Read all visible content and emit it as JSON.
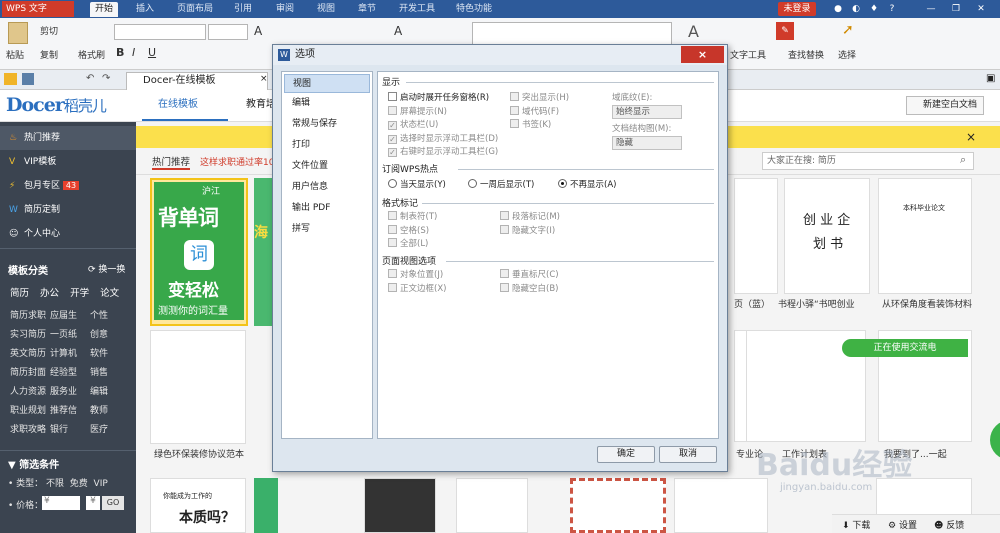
{
  "app": {
    "name": "WPS 文字",
    "login": "未登录"
  },
  "menu": [
    "开始",
    "插入",
    "页面布局",
    "引用",
    "审阅",
    "视图",
    "章节",
    "开发工具",
    "特色功能"
  ],
  "ribbon": {
    "paste": "粘贴",
    "cut": "剪切",
    "copy": "复制",
    "format_painter": "格式刷",
    "text_tools": "文字工具",
    "find_replace": "查找替换",
    "select": "选择"
  },
  "tab": {
    "name": "Docer-在线模板"
  },
  "docer": {
    "logo": "Docer",
    "logo_cn": "稻壳儿",
    "tab_online": "在线模板",
    "tab_edu": "教育培训",
    "new_blank": "新建空白文档"
  },
  "sidebar": {
    "items": [
      "热门推荐",
      "VIP模板",
      "包月专区",
      "简历定制",
      "个人中心"
    ],
    "month_badge": "43",
    "category_title": "模板分类",
    "switch": "换一换",
    "tags_row": [
      "简历",
      "办公",
      "开学",
      "论文"
    ],
    "cats": [
      [
        "简历求职",
        "应届生",
        "个性"
      ],
      [
        "实习简历",
        "一页纸",
        "创意"
      ],
      [
        "英文简历",
        "计算机",
        "软件"
      ],
      [
        "简历封面",
        "经验型",
        "销售"
      ],
      [
        "人力资源",
        "服务业",
        "编辑"
      ],
      [
        "职业规划",
        "推荐信",
        "教师"
      ],
      [
        "求职攻略",
        "银行",
        "医疗"
      ]
    ],
    "filter_title": "筛选条件",
    "type_label": "• 类型：",
    "type_opts": [
      "不限",
      "免费",
      "VIP"
    ],
    "price_label": "• 价格：",
    "price_unit": "¥",
    "go": "GO"
  },
  "content": {
    "hot_tab": "热门推荐",
    "promo": "这样求职通过率100",
    "search_placeholder": "大家正在搜: 简历",
    "card1_brand": "沪江",
    "card1_title": "背单词",
    "card1_sub": "变轻松",
    "card1_foot": "测测你的词汇量",
    "card2_char": "海",
    "doc_title": "创 业 企",
    "doc_title2": "划 书",
    "doc_header": "本科毕业论文",
    "captions": [
      "绿色环保装修协议范本",
      "页（蓝）",
      "书程小驿“书吧创业",
      "从环保角度看装饰材料",
      "工作计划表",
      "专业论",
      "我要到了...一起"
    ],
    "exchange": "正在使用交流电",
    "bottom_card_line": "你能成为工作的",
    "bottom_card_big": "本质吗",
    "bottom_card_q": "？",
    "bottom_actions": [
      "下载",
      "设置",
      "反馈"
    ],
    "watermark": "Baidu经验",
    "watermark_url": "jingyan.baidu.com"
  },
  "dialog": {
    "title": "选项",
    "close": "×",
    "nav": [
      "视图",
      "编辑",
      "常规与保存",
      "打印",
      "文件位置",
      "用户信息",
      "输出 PDF",
      "拼写"
    ],
    "sections": {
      "display": "显示",
      "hotspot": "订阅WPS热点",
      "format_marks": "格式标记",
      "page_view": "页面视图选项"
    },
    "display_options": [
      {
        "label": "启动时展开任务窗格(R)",
        "checked": false,
        "enabled": true
      },
      {
        "label": "屏幕提示(N)",
        "checked": false,
        "enabled": false
      },
      {
        "label": "状态栏(U)",
        "checked": true,
        "enabled": false
      },
      {
        "label": "选择时显示浮动工具栏(D)",
        "checked": true,
        "enabled": false
      },
      {
        "label": "右键时显示浮动工具栏(G)",
        "checked": true,
        "enabled": false
      }
    ],
    "display_options_mid": [
      {
        "label": "突出显示(H)",
        "checked": false,
        "enabled": false
      },
      {
        "label": "域代码(F)",
        "checked": false,
        "enabled": false
      },
      {
        "label": "书签(K)",
        "checked": false,
        "enabled": false
      }
    ],
    "field_shading_label": "域底纹(E):",
    "field_shading_value": "始终显示",
    "doc_map_label": "文档结构图(M):",
    "doc_map_value": "隐藏",
    "hotspot_options": [
      {
        "label": "当天显示(Y)",
        "selected": false
      },
      {
        "label": "一周后显示(T)",
        "selected": false
      },
      {
        "label": "不再显示(A)",
        "selected": true
      }
    ],
    "format_left": [
      "制表符(T)",
      "空格(S)",
      "全部(L)"
    ],
    "format_right": [
      "段落标记(M)",
      "隐藏文字(I)"
    ],
    "page_left": [
      "对象位置(J)",
      "正文边框(X)"
    ],
    "page_right": [
      "垂直标尺(C)",
      "隐藏空白(B)"
    ],
    "ok": "确定",
    "cancel": "取消"
  }
}
